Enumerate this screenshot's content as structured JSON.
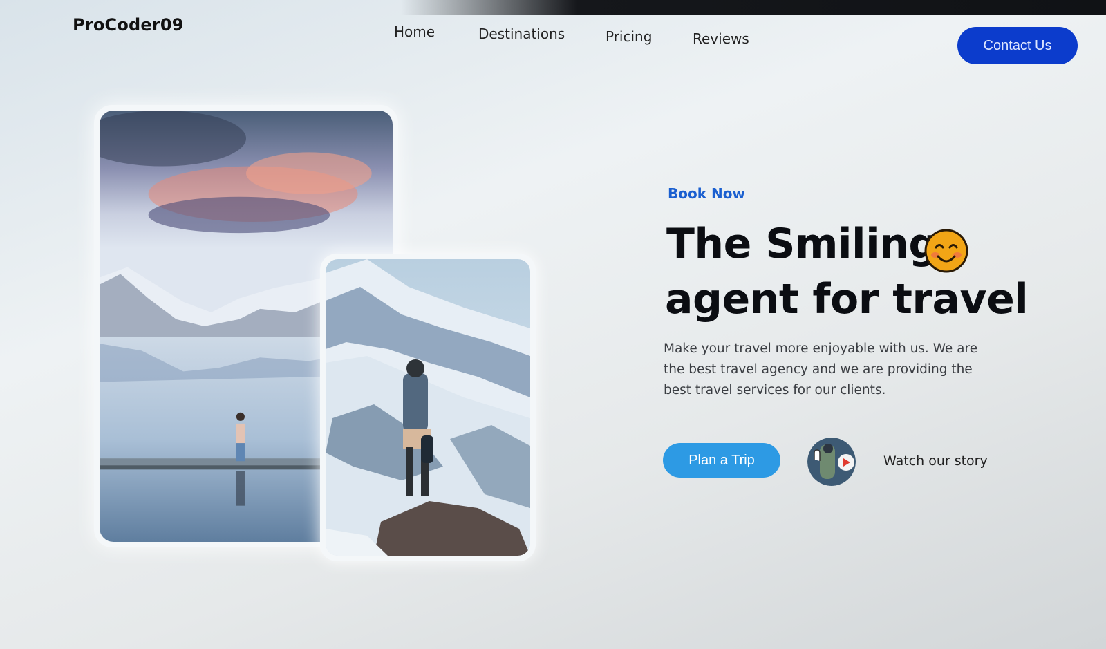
{
  "header": {
    "brand": "ProCoder09",
    "nav": [
      "Home",
      "Destinations",
      "Pricing",
      "Reviews"
    ],
    "contact_label": "Contact Us"
  },
  "hero": {
    "eyebrow": "Book Now",
    "title_line1": "The Smiling",
    "title_line2": "agent for travel",
    "emoji_icon": "smiling-face-icon",
    "description": "Make your travel more enjoyable with us. We are the best travel agency and we are providing the best travel services for our clients.",
    "primary_cta": "Plan a Trip",
    "secondary_cta": "Watch our story"
  },
  "colors": {
    "contact_button": "#0c3ccc",
    "primary_cta": "#2d9ae4",
    "eyebrow": "#1a5fd0",
    "title": "#0b0d12"
  }
}
